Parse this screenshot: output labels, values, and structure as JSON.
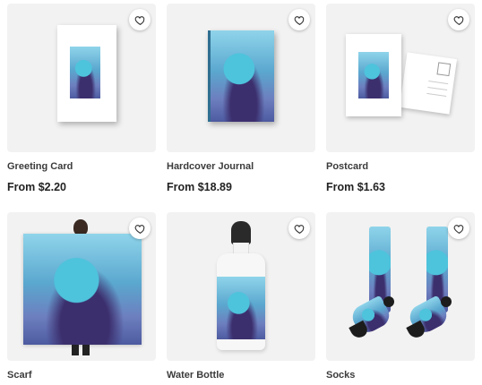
{
  "products": [
    {
      "title": "Greeting Card",
      "price": "From $2.20"
    },
    {
      "title": "Hardcover Journal",
      "price": "From $18.89"
    },
    {
      "title": "Postcard",
      "price": "From $1.63"
    },
    {
      "title": "Scarf",
      "price": ""
    },
    {
      "title": "Water Bottle",
      "price": ""
    },
    {
      "title": "Socks",
      "price": ""
    }
  ],
  "icons": {
    "favorite": "heart-icon"
  },
  "colors": {
    "thumbnail_bg": "#f2f2f2",
    "artwork_blue": "#4ec3dc",
    "text": "#222222"
  }
}
